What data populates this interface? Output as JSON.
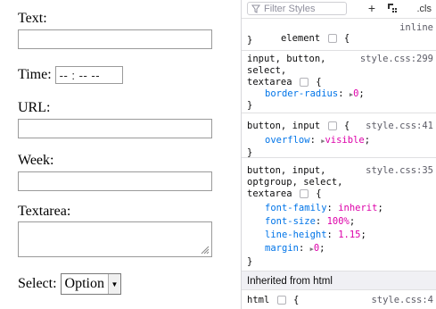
{
  "form": {
    "text_label": "Text:",
    "time_label": "Time:",
    "time_value": "-- : --  --",
    "url_label": "URL:",
    "week_label": "Week:",
    "textarea_label": "Textarea:",
    "select_label": "Select:",
    "select_value": "Option"
  },
  "devtools": {
    "filter_placeholder": "Filter Styles",
    "cls_label": ".cls",
    "rules": [
      {
        "selector": "element",
        "brace": "{",
        "source": "inline",
        "close": "}"
      },
      {
        "selector_lines": [
          "input, button,",
          "select,",
          "textarea"
        ],
        "source": "style.css:299",
        "decls": [
          {
            "prop": "border-radius",
            "value": "0"
          }
        ]
      },
      {
        "selector": "button, input",
        "source": "style.css:41",
        "decls": [
          {
            "prop": "overflow",
            "value": "visible"
          }
        ]
      },
      {
        "selector_lines": [
          "button, input,",
          "optgroup, select,",
          "textarea"
        ],
        "source": "style.css:35",
        "decls": [
          {
            "prop": "font-family",
            "value": "inherit"
          },
          {
            "prop": "font-size",
            "value": "100%"
          },
          {
            "prop": "line-height",
            "value": "1.15"
          },
          {
            "prop": "margin",
            "value": "0"
          }
        ]
      }
    ],
    "inherited_label": "Inherited from html",
    "html_rule": {
      "selector": "html",
      "source": "style.css:4"
    }
  }
}
